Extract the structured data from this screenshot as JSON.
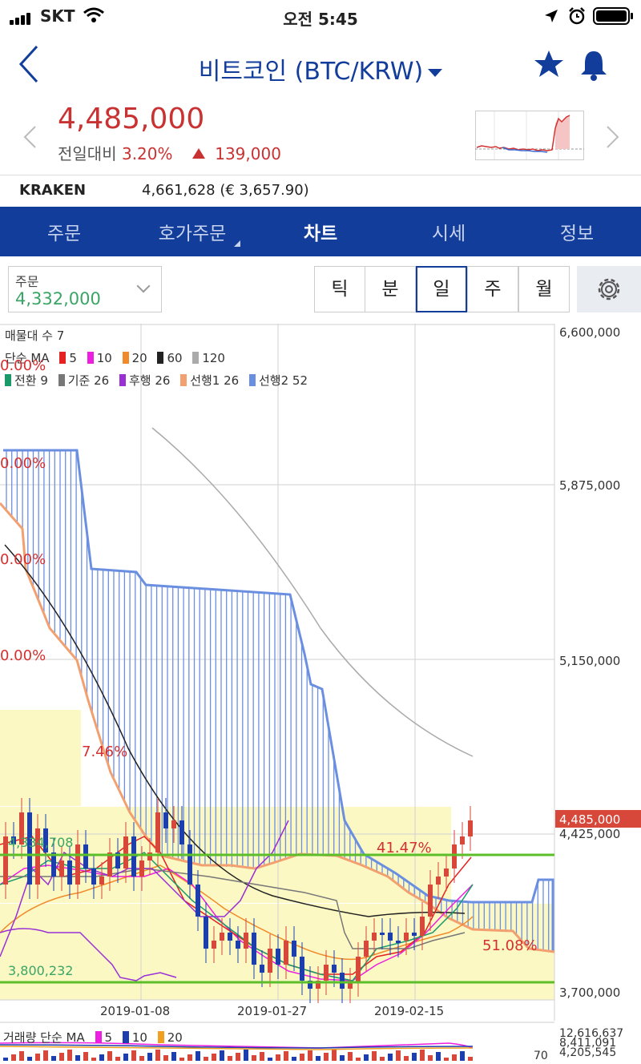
{
  "status_bar": {
    "carrier": "SKT",
    "time": "오전 5:45"
  },
  "header": {
    "title": "비트코인 (BTC/KRW)"
  },
  "quote": {
    "price": "4,485,000",
    "change_label": "전일대비",
    "change_pct": "3.20%",
    "change_abs": "139,000"
  },
  "kraken": {
    "exchange": "KRAKEN",
    "value": "4,661,628 (€ 3,657.90)"
  },
  "tabs": [
    {
      "label": "주문"
    },
    {
      "label": "호가주문"
    },
    {
      "label": "차트"
    },
    {
      "label": "시세"
    },
    {
      "label": "정보"
    }
  ],
  "order_box": {
    "label": "주문",
    "value": "4,332,000"
  },
  "periods": [
    {
      "label": "틱"
    },
    {
      "label": "분"
    },
    {
      "label": "일"
    },
    {
      "label": "주"
    },
    {
      "label": "월"
    }
  ],
  "colors": {
    "brand": "#123d9a",
    "up": "#d7483a",
    "down": "#1d3fae",
    "accent_green": "#3aa565"
  },
  "legend": {
    "volume_profile": "매물대 수 7",
    "ma_title": "단순 MA",
    "ma": [
      {
        "label": "5",
        "color": "#e52222"
      },
      {
        "label": "10",
        "color": "#ee1ee0"
      },
      {
        "label": "20",
        "color": "#f08a2a"
      },
      {
        "label": "60",
        "color": "#222222"
      },
      {
        "label": "120",
        "color": "#aaaaaa"
      }
    ],
    "ichimoku": [
      {
        "label": "전환 9",
        "color": "#1a9a6a"
      },
      {
        "label": "기준 26",
        "color": "#777777"
      },
      {
        "label": "후행 26",
        "color": "#9a2fd6"
      },
      {
        "label": "선행1 26",
        "color": "#f3a070"
      },
      {
        "label": "선행2 52",
        "color": "#6b8fe0"
      }
    ]
  },
  "price_axis": {
    "ticks": [
      "6,600,000",
      "5,875,000",
      "5,150,000",
      "4,425,000",
      "3,700,000"
    ],
    "current": "4,485,000"
  },
  "date_axis": [
    "2019-01-08",
    "2019-01-27",
    "2019-02-15"
  ],
  "profile_pcts": [
    "0.00%",
    "0.00%",
    "0.00%",
    "0.00%",
    "7.46%",
    "41.47%",
    "51.08%"
  ],
  "lines": {
    "high": "4,334,708",
    "low": "3,800,232"
  },
  "volume": {
    "legend_title": "거래량 단순 MA",
    "ma": [
      {
        "label": "5",
        "color": "#ee1ee0"
      },
      {
        "label": "10",
        "color": "#1d3fae"
      },
      {
        "label": "20",
        "color": "#f0a020"
      }
    ],
    "ticks": [
      "12,616,637",
      "8,411,091",
      "4,205,545"
    ],
    "value": "70"
  },
  "chart_data": {
    "type": "candlestick",
    "ylim": [
      3700000,
      6600000
    ],
    "x": [
      "2019-01-08",
      "2019-01-27",
      "2019-02-15"
    ],
    "last_close": 4485000,
    "support_lines": [
      4334708,
      3800232
    ]
  }
}
